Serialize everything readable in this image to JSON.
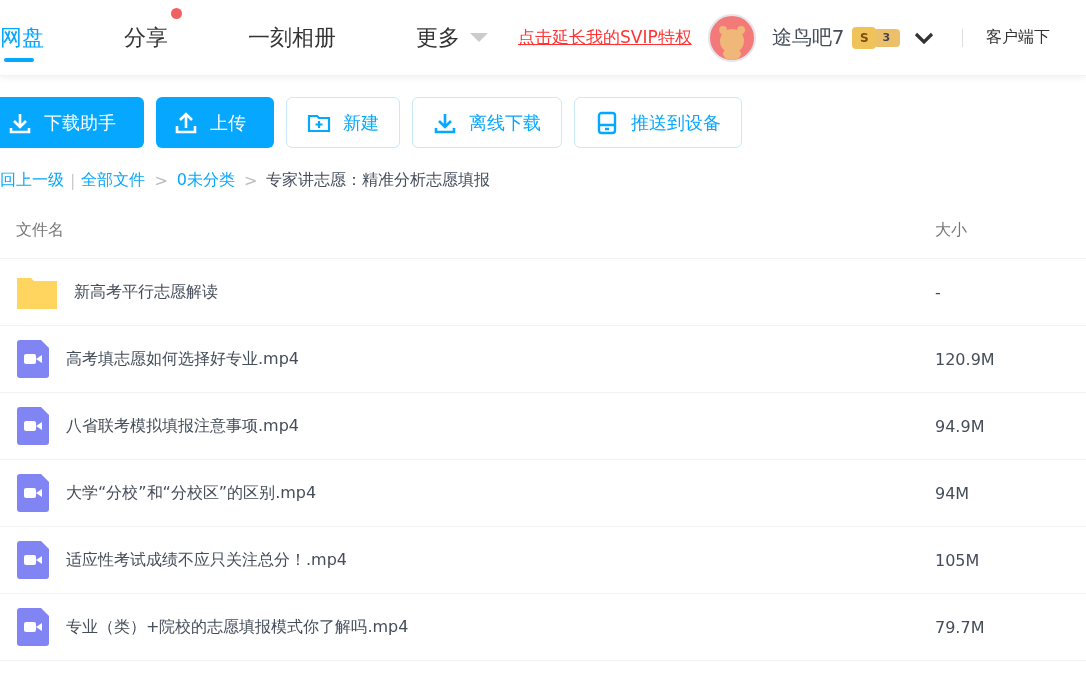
{
  "nav": {
    "tabs": [
      {
        "label": "网盘",
        "selected": true,
        "dot": false
      },
      {
        "label": "分享",
        "selected": false,
        "dot": true
      },
      {
        "label": "一刻相册",
        "selected": false,
        "dot": false
      },
      {
        "label": "更多",
        "selected": false,
        "dot": false,
        "dropdown": true
      }
    ],
    "promo_link": "点击延长我的SVIP特权",
    "user": {
      "name": "途鸟吧7",
      "badge_letter": "S",
      "badge_level": "3"
    },
    "client_link": "客户端下"
  },
  "toolbar": [
    {
      "label": "下载助手",
      "kind": "primary"
    },
    {
      "label": "上传",
      "kind": "primary"
    },
    {
      "label": "新建",
      "kind": "outline"
    },
    {
      "label": "离线下载",
      "kind": "outline"
    },
    {
      "label": "推送到设备",
      "kind": "outline"
    }
  ],
  "breadcrumb": {
    "back": "回上一级",
    "divider": "|",
    "separator": ">",
    "links": [
      "全部文件",
      "0未分类"
    ],
    "current": "专家讲志愿：精准分析志愿填报"
  },
  "table": {
    "columns": [
      "文件名",
      "大小"
    ],
    "rows": [
      {
        "kind": "folder",
        "name": "新高考平行志愿解读",
        "size": "-"
      },
      {
        "kind": "video",
        "name": "高考填志愿如何选择好专业.mp4",
        "size": "120.9M"
      },
      {
        "kind": "video",
        "name": "八省联考模拟填报注意事项.mp4",
        "size": "94.9M"
      },
      {
        "kind": "video",
        "name": "大学“分校”和“分校区”的区别.mp4",
        "size": "94M"
      },
      {
        "kind": "video",
        "name": "适应性考试成绩不应只关注总分！.mp4",
        "size": "105M"
      },
      {
        "kind": "video",
        "name": "专业（类）+院校的志愿填报模式你了解吗.mp4",
        "size": "79.7M"
      }
    ]
  }
}
